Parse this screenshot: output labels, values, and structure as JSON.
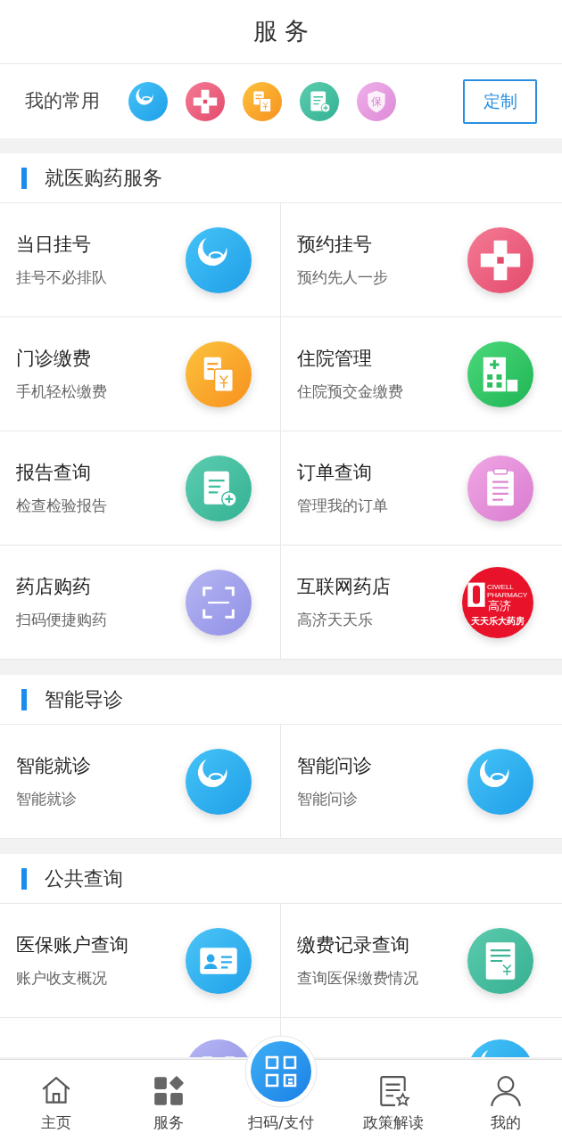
{
  "header": {
    "title": "服 务"
  },
  "favorites": {
    "label": "我的常用",
    "icons": [
      {
        "kind": "si"
      },
      {
        "kind": "cross"
      },
      {
        "kind": "bill"
      },
      {
        "kind": "report"
      },
      {
        "kind": "shield",
        "text": "保"
      }
    ],
    "customize_button": "定制"
  },
  "sections": [
    {
      "title": "就医购药服务",
      "items": [
        {
          "title": "当日挂号",
          "subtitle": "挂号不必排队",
          "icon": {
            "kind": "si"
          }
        },
        {
          "title": "预约挂号",
          "subtitle": "预约先人一步",
          "icon": {
            "kind": "cross"
          }
        },
        {
          "title": "门诊缴费",
          "subtitle": "手机轻松缴费",
          "icon": {
            "kind": "bill"
          }
        },
        {
          "title": "住院管理",
          "subtitle": "住院预交金缴费",
          "icon": {
            "kind": "hospital"
          }
        },
        {
          "title": "报告查询",
          "subtitle": "检查检验报告",
          "icon": {
            "kind": "report"
          }
        },
        {
          "title": "订单查询",
          "subtitle": "管理我的订单",
          "icon": {
            "kind": "order"
          }
        },
        {
          "title": "药店购药",
          "subtitle": "扫码便捷购药",
          "icon": {
            "kind": "scan"
          }
        },
        {
          "title": "互联网药店",
          "subtitle": "高济天天乐",
          "icon": {
            "kind": "pharmacy",
            "texts": [
              "CIWELL",
              "PHARMACY",
              "高济",
              "天天乐大药房"
            ]
          }
        }
      ]
    },
    {
      "title": "智能导诊",
      "items": [
        {
          "title": "智能就诊",
          "subtitle": "智能就诊",
          "icon": {
            "kind": "si"
          }
        },
        {
          "title": "智能问诊",
          "subtitle": "智能问诊",
          "icon": {
            "kind": "si"
          }
        }
      ]
    },
    {
      "title": "公共查询",
      "items": [
        {
          "title": "医保账户查询",
          "subtitle": "账户收支概况",
          "icon": {
            "kind": "idcard"
          }
        },
        {
          "title": "缴费记录查询",
          "subtitle": "查询医保缴费情况",
          "icon": {
            "kind": "record"
          }
        },
        {
          "icon": {
            "kind": "scan"
          }
        },
        {
          "icon": {
            "kind": "si"
          }
        }
      ]
    }
  ],
  "tab_bar": [
    {
      "label": "主页",
      "kind": "home"
    },
    {
      "label": "服务",
      "kind": "grid"
    },
    {
      "label": "扫码/支付",
      "kind": "scan"
    },
    {
      "label": "政策解读",
      "kind": "policy"
    },
    {
      "label": "我的",
      "kind": "user"
    }
  ]
}
